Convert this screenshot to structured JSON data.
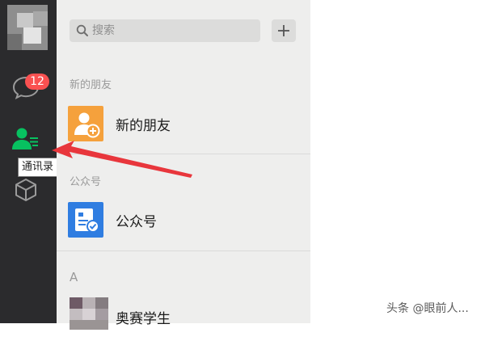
{
  "nav": {
    "chat_badge": "12",
    "tooltip": "通讯录",
    "icons": [
      "avatar",
      "chat-bubble-icon",
      "contacts-icon",
      "cube-icon"
    ]
  },
  "search": {
    "placeholder": "搜索"
  },
  "sections": {
    "new_friends": "新的朋友",
    "official_accounts": "公众号",
    "letter_a": "A"
  },
  "rows": {
    "new_friends": "新的朋友",
    "official_accounts": "公众号",
    "contact_1": "奥赛学生"
  },
  "watermark": "头条 @眼前人...",
  "colors": {
    "nav_bg": "#2b2b2d",
    "list_bg": "#eeeeed",
    "active_green": "#07c160",
    "badge_red": "#fa5151",
    "arrow_red": "#e8363c",
    "new_friend_orange": "#f5a13c",
    "official_blue": "#2f7de1"
  }
}
